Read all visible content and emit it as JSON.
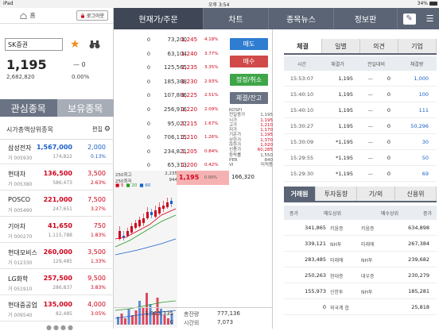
{
  "status": {
    "device": "iPad",
    "time": "오후 3:54",
    "battery": "34%"
  },
  "left": {
    "home_label": "홈",
    "logout_label": "로그아웃",
    "stock_name": "SK증권",
    "price": "1,195",
    "volume": "2,682,820",
    "change": "0",
    "change_pct": "0.00%",
    "tab_interest": "관심종목",
    "tab_holding": "보유종목",
    "list_title": "시가총액상위종목",
    "edit_label": "편집",
    "stocks": [
      {
        "name": "삼성전자",
        "code": "거 005930",
        "price": "1,567,000",
        "vol": "174,822",
        "chg": "2,000",
        "pct": "0.13%",
        "dir": "dn"
      },
      {
        "name": "현대차",
        "code": "거 005380",
        "price": "136,500",
        "vol": "586,473",
        "chg": "3,500",
        "pct": "2.63%",
        "dir": "up"
      },
      {
        "name": "POSCO",
        "code": "거 005490",
        "price": "221,000",
        "vol": "247,651",
        "chg": "7,500",
        "pct": "3.27%",
        "dir": "up"
      },
      {
        "name": "기아차",
        "code": "거 000270",
        "price": "41,650",
        "vol": "1,115,788",
        "chg": "750",
        "pct": "1.83%",
        "dir": "up"
      },
      {
        "name": "현대모비스",
        "code": "거 012330",
        "price": "260,000",
        "vol": "129,485",
        "chg": "3,500",
        "pct": "1.33%",
        "dir": "up"
      },
      {
        "name": "LG화학",
        "code": "거 051910",
        "price": "257,500",
        "vol": "286,837",
        "chg": "9,500",
        "pct": "3.83%",
        "dir": "up"
      },
      {
        "name": "현대중공업",
        "code": "거 009540",
        "price": "135,000",
        "vol": "82,485",
        "chg": "4,000",
        "pct": "3.05%",
        "dir": "up"
      }
    ],
    "pager": "●●●●"
  },
  "nav": {
    "tabs": [
      "현재가/주문",
      "차트",
      "종목뉴스",
      "정보판"
    ]
  },
  "orderbook": {
    "asks": [
      {
        "qty": "0",
        "price": "73,200",
        "p": "1,245",
        "rate": "4.18%"
      },
      {
        "qty": "0",
        "price": "63,104",
        "p": "1,240",
        "rate": "3.77%"
      },
      {
        "qty": "0",
        "price": "125,565",
        "p": "1,235",
        "rate": "3.35%"
      },
      {
        "qty": "0",
        "price": "185,388",
        "p": "1,230",
        "rate": "2.93%"
      },
      {
        "qty": "0",
        "price": "107,886",
        "p": "1,225",
        "rate": "2.51%"
      },
      {
        "qty": "0",
        "price": "256,916",
        "p": "1,220",
        "rate": "2.09%"
      },
      {
        "qty": "0",
        "price": "95,027",
        "p": "1,215",
        "rate": "1.67%"
      },
      {
        "qty": "0",
        "price": "706,115",
        "p": "1,210",
        "rate": "1.26%"
      },
      {
        "qty": "0",
        "price": "234,821",
        "p": "1,205",
        "rate": "0.84%"
      },
      {
        "qty": "0",
        "price": "65,313",
        "p": "1,200",
        "rate": "0.42%"
      }
    ],
    "current": {
      "price": "1,195",
      "rate": "0.00%",
      "qty": "166,320"
    },
    "bids": [
      {
        "p": "1,190",
        "rate": "0.42%",
        "qty": "164,387"
      },
      {
        "p": "1,185",
        "rate": "0.84%",
        "qty": "80,077"
      },
      {
        "p": "1,180",
        "rate": "1.26%",
        "qty": "104,294"
      },
      {
        "p": "1,175",
        "rate": "1.67%",
        "qty": "58,328"
      },
      {
        "p": "1,170",
        "rate": "2.09%",
        "qty": "36,367"
      },
      {
        "p": "1,165",
        "rate": "2.51%",
        "qty": "32,265"
      },
      {
        "p": "1,160",
        "rate": "2.93%",
        "qty": "36,308"
      },
      {
        "p": "1,155",
        "rate": "3.35%",
        "qty": "25,834"
      },
      {
        "p": "1,150",
        "rate": "3.77%",
        "qty": "41,831"
      }
    ],
    "high250": "250최고",
    "high250_val": "2,235",
    "low250": "250최저",
    "low250_val": "944",
    "ma_labels": [
      "5",
      "20",
      "60"
    ],
    "total_ask": "1,913,335",
    "total_label": "총잔량",
    "total_bid": "777,136",
    "after_ask": "0",
    "after_label": "시간외",
    "after_bid": "7,073",
    "buttons": {
      "sell": "매도",
      "buy": "매수",
      "modify": "정정/취소",
      "fill": "체결/잔고"
    },
    "kospi_title": "KOSPI",
    "kospi": [
      {
        "k": "전일종가",
        "v": "1,195"
      },
      {
        "k": "시가",
        "v": "1,195"
      },
      {
        "k": "고가",
        "v": "1,210"
      },
      {
        "k": "저가",
        "v": "1,170"
      },
      {
        "k": "기준가",
        "v": "1,195"
      },
      {
        "k": "상한가",
        "v": "1,370"
      },
      {
        "k": "하한가",
        "v": "1,020"
      },
      {
        "k": "신용가",
        "v": "60,285"
      },
      {
        "k": "등락률",
        "v": "1,550"
      },
      {
        "k": "PER",
        "v": "840"
      },
      {
        "k": "VI",
        "v": "미적용"
      }
    ]
  },
  "right": {
    "tabs1": [
      "체결",
      "일별",
      "의견",
      "기업"
    ],
    "fill_headers": [
      "시간",
      "체결가",
      "전일대비",
      "체결량"
    ],
    "fills": [
      {
        "t": "15:53:07",
        "p": "1,195",
        "c": "—",
        "cp": "0",
        "v": "1,000"
      },
      {
        "t": "15:40:10",
        "p": "1,195",
        "c": "—",
        "cp": "0",
        "v": "100"
      },
      {
        "t": "15:40:10",
        "p": "1,195",
        "c": "—",
        "cp": "0",
        "v": "111"
      },
      {
        "t": "15:30:27",
        "p": "1,195",
        "c": "—",
        "cp": "0",
        "v": "50,296"
      },
      {
        "t": "15:30:09",
        "p": "*1,195",
        "c": "—",
        "cp": "0",
        "v": "30"
      },
      {
        "t": "15:29:55",
        "p": "*1,195",
        "c": "—",
        "cp": "0",
        "v": "50"
      },
      {
        "t": "15:29:30",
        "p": "*1,195",
        "c": "—",
        "cp": "0",
        "v": "69"
      }
    ],
    "tabs2": [
      "거래원",
      "투자동향",
      "기/외",
      "신용위"
    ],
    "broker_headers": [
      "증가",
      "매도상위",
      "매수상위",
      "증가"
    ],
    "brokers": [
      {
        "sv": "341,865",
        "sn": "키움증",
        "bn": "키움증",
        "bv": "634,898"
      },
      {
        "sv": "339,121",
        "sn": "NH투",
        "bn": "미래에",
        "bv": "267,384"
      },
      {
        "sv": "283,485",
        "sn": "미래에",
        "bn": "NH투",
        "bv": "239,682"
      },
      {
        "sv": "250,263",
        "sn": "현대증",
        "bn": "대우증",
        "bv": "230,279"
      },
      {
        "sv": "155,973",
        "sn": "신한투",
        "bn": "NH투",
        "bv": "185,281"
      },
      {
        "sv": "0",
        "sn": "외국계 합",
        "bn": "",
        "bv": "25,818"
      }
    ]
  },
  "colors": {
    "up": "#d0021b",
    "down": "#1a5fc8",
    "nav": "#5a6475"
  }
}
